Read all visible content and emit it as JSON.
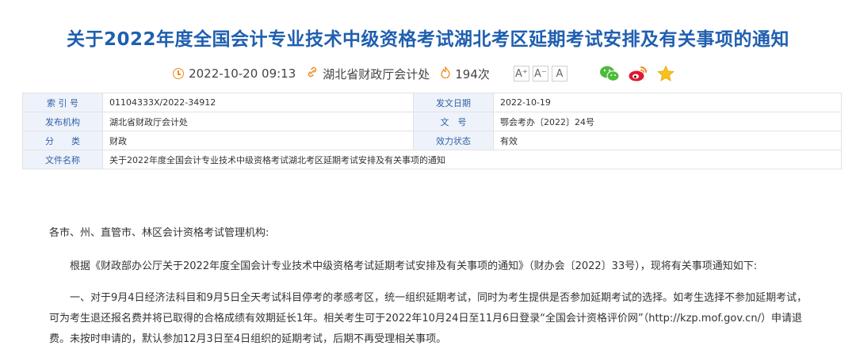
{
  "article": {
    "title": "关于2022年度全国会计专业技术中级资格考试湖北考区延期考试安排及有关事项的通知",
    "datetime": "2022-10-20 09:13",
    "source": "湖北省财政厅会计处",
    "views": "194次",
    "font_buttons": [
      "A⁺",
      "A⁻",
      "A"
    ]
  },
  "info": {
    "index_label": "索 引 号",
    "index_value": "01104333X/2022-34912",
    "date_label": "发文日期",
    "date_value": "2022-10-19",
    "org_label": "发布机构",
    "org_value": "湖北省财政厅会计处",
    "docno_label": "文　号",
    "docno_value": "鄂会考办〔2022〕24号",
    "category_label": "分　　类",
    "category_value": "财政",
    "status_label": "效力状态",
    "status_value": "有效",
    "name_label": "文件名称",
    "name_value": "关于2022年度全国会计专业技术中级资格考试湖北考区延期考试安排及有关事项的通知"
  },
  "body": {
    "salutation": "各市、州、直管市、林区会计资格考试管理机构:",
    "para1": "根据《财政部办公厅关于2022年度全国会计专业技术中级资格考试延期考试安排及有关事项的通知》（财办会〔2022〕33号），现将有关事项通知如下:",
    "para2": "一、对于9月4日经济法科目和9月5日全天考试科目停考的孝感考区，统一组织延期考试，同时为考生提供是否参加延期考试的选择。如考生选择不参加延期考试，可为考生退还报名费并将已取得的合格成绩有效期延长1年。相关考生可于2022年10月24日至11月6日登录“全国会计资格评价网”（http://kzp.mof.gov.cn/）申请退费。未按时申请的，默认参加12月3日至4日组织的延期考试，后期不再受理相关事项。"
  },
  "colors": {
    "title": "#1f5fb0",
    "label_bg": "#eef3fb",
    "accent": "#f08a1c"
  }
}
